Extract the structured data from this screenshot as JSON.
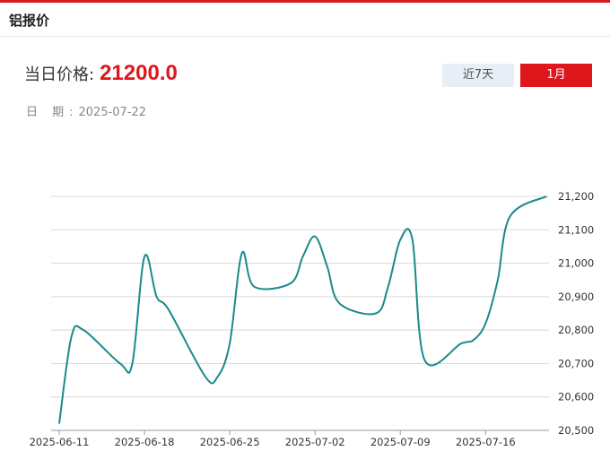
{
  "panel": {
    "title": "铝报价"
  },
  "price": {
    "label": "当日价格:",
    "value": "21200.0"
  },
  "date": {
    "label": "日 期:",
    "value": "2025-07-22"
  },
  "tabs": {
    "week": "近7天",
    "month": "1月",
    "active": "month"
  },
  "colors": {
    "accent": "#e0161d",
    "line": "#1a8a8a",
    "grid": "#d9d9d9"
  },
  "chart_data": {
    "type": "line",
    "ylim": [
      20500,
      21200
    ],
    "y_ticks": [
      "20,500",
      "20,600",
      "20,700",
      "20,800",
      "20,900",
      "21,000",
      "21,100",
      "21,200"
    ],
    "x_tick_labels": [
      "2025-06-11",
      "2025-06-18",
      "2025-06-25",
      "2025-07-02",
      "2025-07-09",
      "2025-07-16"
    ],
    "grid": "horizontal",
    "series": [
      {
        "values": [
          [
            "2025-06-11",
            20520
          ],
          [
            "2025-06-12",
            20780
          ],
          [
            "2025-06-13",
            20800
          ],
          [
            "2025-06-16",
            20700
          ],
          [
            "2025-06-17",
            20700
          ],
          [
            "2025-06-18",
            21020
          ],
          [
            "2025-06-19",
            20900
          ],
          [
            "2025-06-20",
            20860
          ],
          [
            "2025-06-23",
            20660
          ],
          [
            "2025-06-24",
            20660
          ],
          [
            "2025-06-25",
            20760
          ],
          [
            "2025-06-26",
            21030
          ],
          [
            "2025-06-27",
            20930
          ],
          [
            "2025-06-30",
            20940
          ],
          [
            "2025-07-01",
            21020
          ],
          [
            "2025-07-02",
            21080
          ],
          [
            "2025-07-03",
            20990
          ],
          [
            "2025-07-04",
            20880
          ],
          [
            "2025-07-07",
            20850
          ],
          [
            "2025-07-08",
            20930
          ],
          [
            "2025-07-09",
            21070
          ],
          [
            "2025-07-10",
            21070
          ],
          [
            "2025-07-11",
            20710
          ],
          [
            "2025-07-14",
            20760
          ],
          [
            "2025-07-15",
            20770
          ],
          [
            "2025-07-16",
            20820
          ],
          [
            "2025-07-17",
            20950
          ],
          [
            "2025-07-18",
            21140
          ],
          [
            "2025-07-21",
            21200
          ]
        ]
      }
    ]
  }
}
